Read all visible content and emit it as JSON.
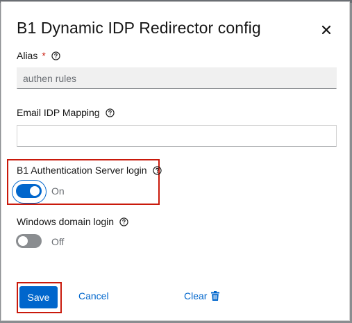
{
  "modal": {
    "title": "B1 Dynamic IDP Redirector config",
    "close_icon": "close-icon"
  },
  "fields": {
    "alias": {
      "label": "Alias",
      "required_mark": "*",
      "value": "authen rules",
      "readonly": true
    },
    "email_idp_mapping": {
      "label": "Email IDP Mapping",
      "value": "",
      "placeholder": ""
    },
    "b1_auth_server_login": {
      "label": "B1 Authentication Server login",
      "state_text": "On",
      "checked": true
    },
    "windows_domain_login": {
      "label": "Windows domain login",
      "state_text": "Off",
      "checked": false
    }
  },
  "actions": {
    "save_label": "Save",
    "cancel_label": "Cancel",
    "clear_label": "Clear",
    "clear_icon": "trash-icon"
  },
  "colors": {
    "primary": "#0066cc",
    "required": "#c9190b",
    "highlight": "#c9190b"
  }
}
